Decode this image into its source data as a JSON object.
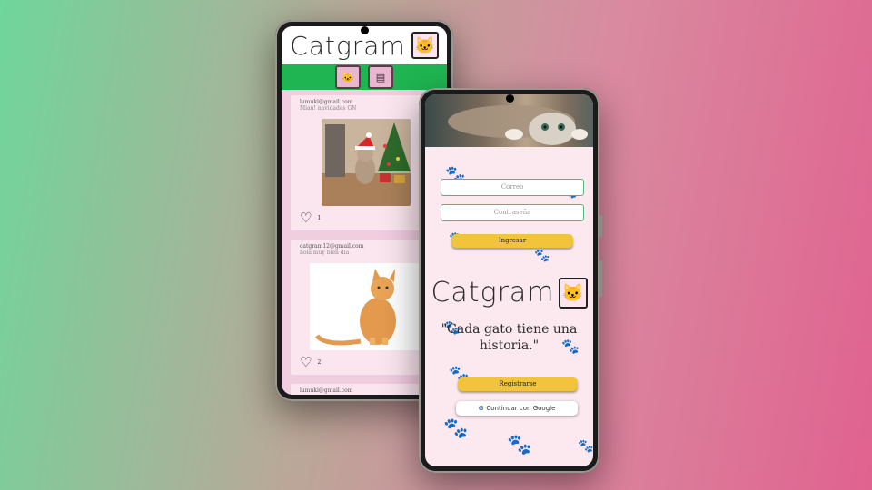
{
  "app": {
    "name": "Catgram"
  },
  "feed_screen": {
    "nav": {
      "home_icon": "cat-home-icon",
      "upload_icon": "upload-frame-icon"
    },
    "posts": [
      {
        "email": "lumuki@gmail.com",
        "caption": "Miau! navidades GN",
        "likes": "1",
        "image": "cat-christmas-photo"
      },
      {
        "email": "catgram12@gmail.com",
        "caption": "hola muy bien dia",
        "likes": "2",
        "image": "orange-cat-photo"
      },
      {
        "email": "lumuki@gmail.com",
        "caption": "",
        "likes": "",
        "image": ""
      }
    ]
  },
  "login_screen": {
    "email_placeholder": "Correo",
    "password_placeholder": "Contraseña",
    "login_label": "Ingresar",
    "tagline": "\"Cada gato tiene una historia.\"",
    "register_label": "Registrarse",
    "google_label": "Continuar con Google"
  },
  "colors": {
    "nav_green": "#1fb552",
    "accent_yellow": "#f1c43c",
    "pink_bg": "#f1cde0",
    "field_border": "#57b67c"
  }
}
